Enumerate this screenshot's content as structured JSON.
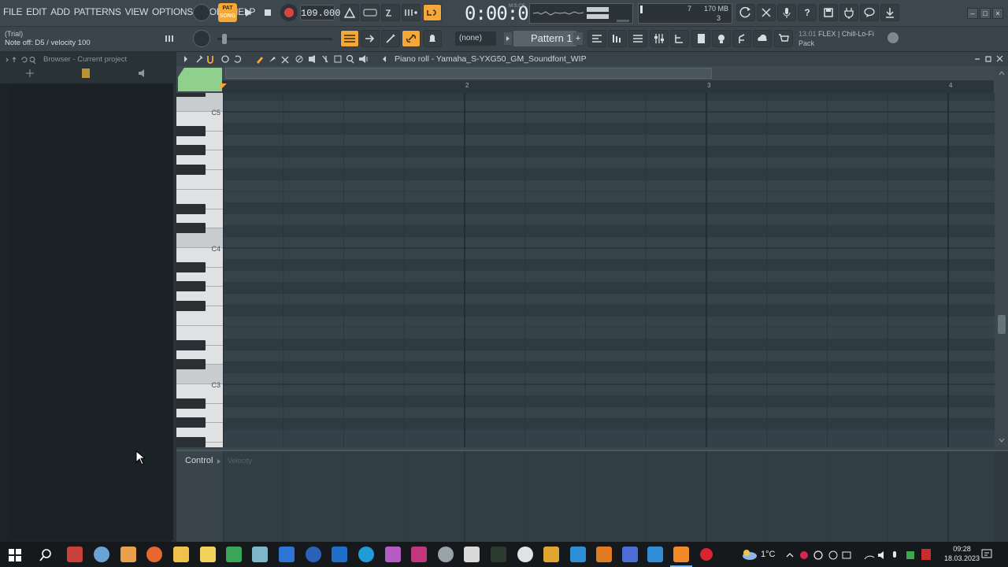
{
  "menu": [
    "FILE",
    "EDIT",
    "ADD",
    "PATTERNS",
    "VIEW",
    "OPTIONS",
    "TOOLS",
    "HELP"
  ],
  "transport": {
    "pat_label": "PAT",
    "song_label": "SONG",
    "tempo": "109.000",
    "time": "0:00:00",
    "time_unit": "M:S:CS"
  },
  "monitor": {
    "memory": "170 MB",
    "cpu_num": "7",
    "polyphony": "3"
  },
  "hint": {
    "mode": "(Trial)",
    "text": "Note off: D5 / velocity 100"
  },
  "pattern": {
    "channel": "(none)",
    "name": "Pattern 1"
  },
  "news": {
    "version": "13.01",
    "text": "FLEX | Chill-Lo-Fi Pack"
  },
  "browser": {
    "title": "Browser - Current project"
  },
  "piano_roll": {
    "title": "Piano roll - Yamaha_S-YXG50_GM_Soundfont_WIP",
    "bars": [
      "2",
      "3",
      "4"
    ],
    "note_labels": [
      "C5",
      "C4",
      "C3"
    ]
  },
  "control": {
    "label": "Control",
    "target": "Velocity"
  },
  "taskbar": {
    "temperature": "1°C",
    "time": "09:28",
    "date": "18.03.2023"
  },
  "colors": {
    "accent_orange": "#f4a83a",
    "keys_corner_green": "#8fd08d",
    "grid_bg": "#34414a"
  }
}
